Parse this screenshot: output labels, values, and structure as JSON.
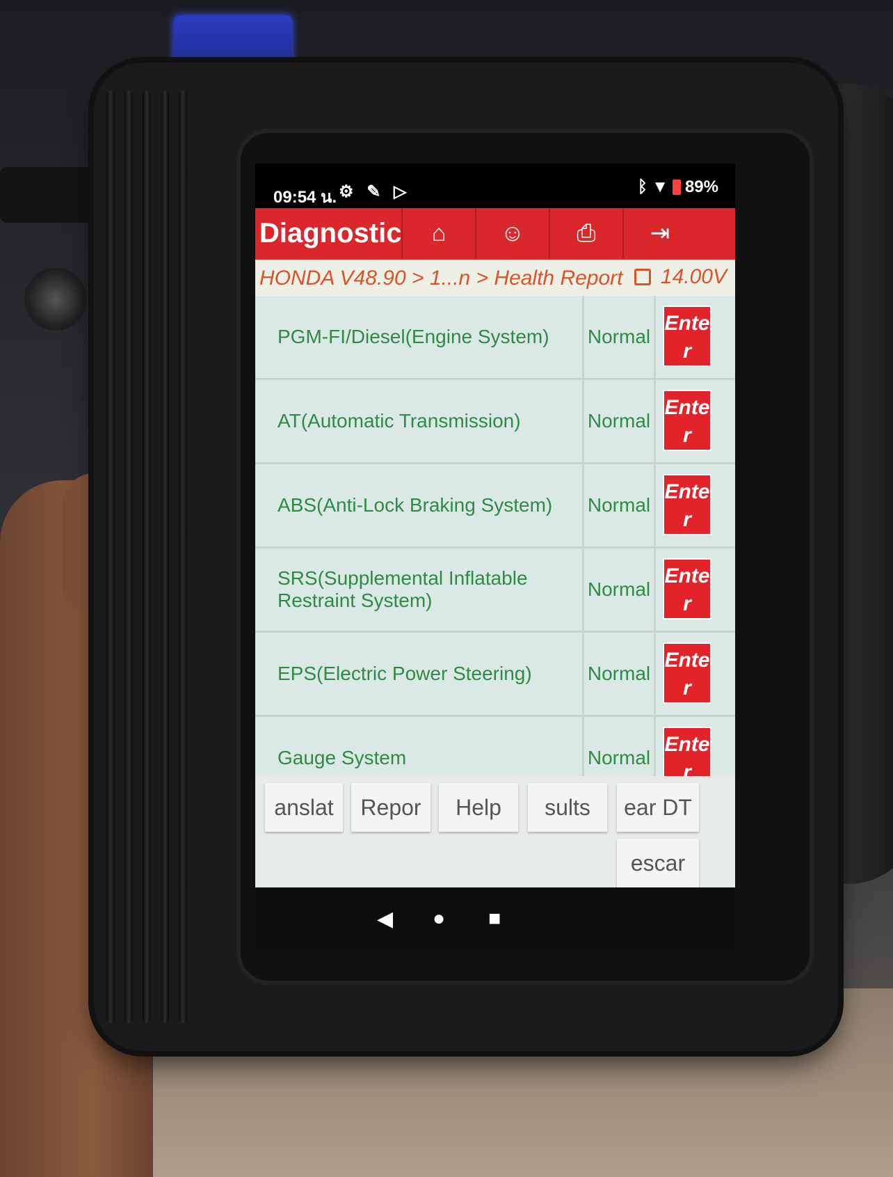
{
  "status_bar": {
    "time": "09:54 น.",
    "left_icons": [
      "settings-icon",
      "tools-icon",
      "play-store-icon"
    ],
    "right_icons": [
      "bluetooth-icon",
      "wifi-icon",
      "battery-icon"
    ],
    "battery": "89%"
  },
  "toolbar": {
    "title": "Diagnostic",
    "buttons": [
      "home-icon",
      "user-icon",
      "print-icon",
      "exit-icon"
    ]
  },
  "breadcrumb": {
    "path": "HONDA V48.90 > 1...n > Health Report",
    "voltage": "14.00V"
  },
  "systems": [
    {
      "name": "PGM-FI/Diesel(Engine System)",
      "status": "Normal",
      "action": "Enter"
    },
    {
      "name": "AT(Automatic Transmission)",
      "status": "Normal",
      "action": "Enter"
    },
    {
      "name": "ABS(Anti-Lock Braking System)",
      "status": "Normal",
      "action": "Enter"
    },
    {
      "name": "SRS(Supplemental Inflatable Restraint System)",
      "status": "Normal",
      "action": "Enter"
    },
    {
      "name": "EPS(Electric Power Steering)",
      "status": "Normal",
      "action": "Enter"
    },
    {
      "name": "Gauge System",
      "status": "Normal",
      "action": "Enter"
    }
  ],
  "bottom_buttons": {
    "translate": "anslat",
    "report": "Repor",
    "help": "Help",
    "results": "sults",
    "clear_dtc": "ear DT",
    "escape": "escar"
  },
  "colors": {
    "accent_red": "#d9272c",
    "status_green": "#2f8a44",
    "list_background": "#dbe9e6"
  }
}
